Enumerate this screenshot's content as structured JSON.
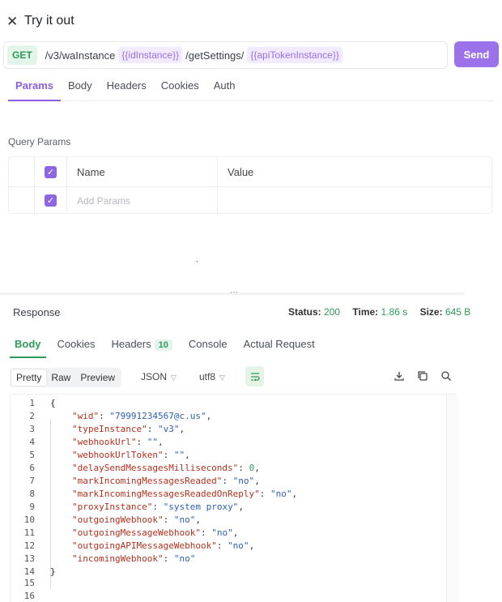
{
  "header": {
    "close_icon": "close-icon",
    "title": "Try it out"
  },
  "request": {
    "method": "GET",
    "url_prefix": "/v3/waInstance",
    "var1": "{{idInstance}}",
    "url_middle": "/getSettings/",
    "var2": "{{apiTokenInstance}}",
    "send_label": "Send"
  },
  "request_tabs": [
    "Params",
    "Body",
    "Headers",
    "Cookies",
    "Auth"
  ],
  "query_params": {
    "label": "Query Params",
    "col_name": "Name",
    "col_value": "Value",
    "add_placeholder": "Add Params"
  },
  "response": {
    "label": "Response",
    "status_label": "Status:",
    "status_value": "200",
    "time_label": "Time:",
    "time_value": "1.86 s",
    "size_label": "Size:",
    "size_value": "645 B",
    "tabs": {
      "body": "Body",
      "cookies": "Cookies",
      "headers": "Headers",
      "headers_count": "10",
      "console": "Console",
      "actual_request": "Actual Request"
    },
    "view": {
      "pretty": "Pretty",
      "raw": "Raw",
      "preview": "Preview",
      "format": "JSON",
      "encoding": "utf8"
    },
    "icons": [
      "wrap-lines-icon",
      "download-icon",
      "copy-icon",
      "search-icon"
    ],
    "lines": [
      {
        "n": "1",
        "key": "",
        "val": "",
        "text": "{"
      },
      {
        "n": "2",
        "key": "\"wid\"",
        "val": "\"79991234567@c.us\"",
        "type": "str",
        "end": ","
      },
      {
        "n": "3",
        "key": "\"typeInstance\"",
        "val": "\"v3\"",
        "type": "str",
        "end": ","
      },
      {
        "n": "4",
        "key": "\"webhookUrl\"",
        "val": "\"\"",
        "type": "str",
        "end": ","
      },
      {
        "n": "5",
        "key": "\"webhookUrlToken\"",
        "val": "\"\"",
        "type": "str",
        "end": ","
      },
      {
        "n": "6",
        "key": "\"delaySendMessagesMilliseconds\"",
        "val": "0",
        "type": "num",
        "end": ","
      },
      {
        "n": "7",
        "key": "\"markIncomingMessagesReaded\"",
        "val": "\"no\"",
        "type": "str",
        "end": ","
      },
      {
        "n": "8",
        "key": "\"markIncomingMessagesReadedOnReply\"",
        "val": "\"no\"",
        "type": "str",
        "end": ","
      },
      {
        "n": "9",
        "key": "\"proxyInstance\"",
        "val": "\"system proxy\"",
        "type": "str",
        "end": ","
      },
      {
        "n": "10",
        "key": "\"outgoingWebhook\"",
        "val": "\"no\"",
        "type": "str",
        "end": ","
      },
      {
        "n": "11",
        "key": "\"outgoingMessageWebhook\"",
        "val": "\"no\"",
        "type": "str",
        "end": ","
      },
      {
        "n": "12",
        "key": "\"outgoingAPIMessageWebhook\"",
        "val": "\"no\"",
        "type": "str",
        "end": ","
      },
      {
        "n": "13",
        "key": "\"incomingWebhook\"",
        "val": "\"no\"",
        "type": "str",
        "end": ""
      },
      {
        "n": "14",
        "key": "",
        "val": "",
        "text": "}"
      },
      {
        "n": "15",
        "key": "",
        "val": "",
        "text": ""
      },
      {
        "n": "16",
        "key": "",
        "val": "",
        "text": ""
      }
    ]
  }
}
